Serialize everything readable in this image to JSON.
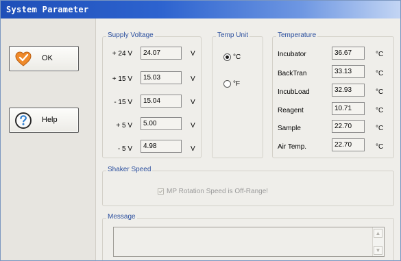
{
  "window": {
    "title": "System Parameter"
  },
  "buttons": {
    "ok": "OK",
    "help": "Help"
  },
  "supply_voltage": {
    "title": "Supply Voltage",
    "rows": [
      {
        "label": "+ 24 V",
        "value": "24.07",
        "unit": "V"
      },
      {
        "label": "+ 15 V",
        "value": "15.03",
        "unit": "V"
      },
      {
        "label": "- 15 V",
        "value": "15.04",
        "unit": "V"
      },
      {
        "label": "+ 5 V",
        "value": "5.00",
        "unit": "V"
      },
      {
        "label": "- 5 V",
        "value": "4.98",
        "unit": "V"
      }
    ]
  },
  "temp_unit": {
    "title": "Temp Unit",
    "options": [
      {
        "label": "°C",
        "selected": true
      },
      {
        "label": "°F",
        "selected": false
      }
    ]
  },
  "temperature": {
    "title": "Temperature",
    "rows": [
      {
        "label": "Incubator",
        "value": "36.67",
        "unit": "°C"
      },
      {
        "label": "BackTran",
        "value": "33.13",
        "unit": "°C"
      },
      {
        "label": "IncubLoad",
        "value": "32.93",
        "unit": "°C"
      },
      {
        "label": "Reagent",
        "value": "10.71",
        "unit": "°C"
      },
      {
        "label": "Sample",
        "value": "22.70",
        "unit": "°C"
      },
      {
        "label": "Air Temp.",
        "value": "22.70",
        "unit": "°C"
      }
    ]
  },
  "shaker_speed": {
    "title": "Shaker Speed",
    "status_label": "MP Rotation Speed is Off-Range!",
    "checked": true
  },
  "message": {
    "title": "Message",
    "text": ""
  },
  "icons": {
    "ok": "heart-check-icon",
    "help": "question-circle-icon"
  }
}
